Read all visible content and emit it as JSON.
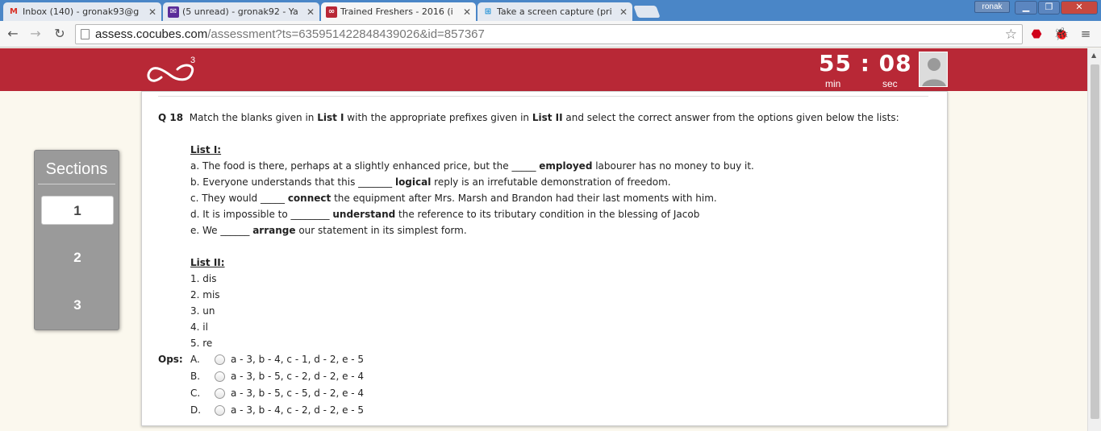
{
  "browser": {
    "tabs": [
      {
        "label": "Inbox (140) - gronak93@g",
        "icon": "gmail-icon"
      },
      {
        "label": "(5 unread) - gronak92 - Ya",
        "icon": "yahoo-mail-icon"
      },
      {
        "label": "Trained Freshers - 2016 (i",
        "icon": "cocubes-icon"
      },
      {
        "label": "Take a screen capture (pri",
        "icon": "windows-icon"
      }
    ],
    "user": "ronak",
    "url_domain": "assess.cocubes.com",
    "url_path": "/assessment?ts=635951422848439026&id=857367"
  },
  "timer": {
    "minutes": "55",
    "separator": ":",
    "seconds": "08",
    "min_label": "min",
    "sec_label": "sec"
  },
  "logo": {
    "superscript": "3"
  },
  "sections": {
    "title": "Sections",
    "items": [
      {
        "label": "1",
        "active": true
      },
      {
        "label": "2",
        "active": false
      },
      {
        "label": "3",
        "active": false
      }
    ]
  },
  "question": {
    "number": "Q 18",
    "stem_1": "Match the blanks given in ",
    "list1_ref": "List I",
    "stem_2": " with the appropriate prefixes given in ",
    "list2_ref": "List II",
    "stem_3": " and select the correct answer from the options given below the lists:",
    "list1_title": "List I:",
    "list1": [
      {
        "pre": "a. The food is there, perhaps at a slightly enhanced price, but the _____ ",
        "word": "employed",
        "post": " labourer has no money to buy it."
      },
      {
        "pre": "b. Everyone understands that this _______ ",
        "word": "logical",
        "post": " reply is an irrefutable demonstration of freedom."
      },
      {
        "pre": "c. They would _____ ",
        "word": "connect",
        "post": " the equipment after Mrs. Marsh and Brandon had their last moments with him."
      },
      {
        "pre": "d. It is impossible to ________ ",
        "word": "understand",
        "post": " the reference to its tributary condition in the blessing of Jacob"
      },
      {
        "pre": "e. We ______ ",
        "word": "arrange",
        "post": " our statement in its simplest form."
      }
    ],
    "list2_title": "List II:",
    "list2": [
      "1. dis",
      "2. mis",
      "3. un",
      "4. il",
      "5. re"
    ],
    "ops_label": "Ops:",
    "options": [
      {
        "letter": "A.",
        "text": "a - 3, b - 4, c - 1, d - 2, e - 5"
      },
      {
        "letter": "B.",
        "text": "a - 3, b - 5, c - 2, d - 2, e - 4"
      },
      {
        "letter": "C.",
        "text": "a - 3, b - 5, c - 5, d - 2, e - 4"
      },
      {
        "letter": "D.",
        "text": "a - 3, b - 4, c - 2, d - 2, e - 5"
      }
    ]
  },
  "colors": {
    "header": "#b82836",
    "sections_panel": "#9a9a9a",
    "page_bg": "#fbf8ee"
  }
}
